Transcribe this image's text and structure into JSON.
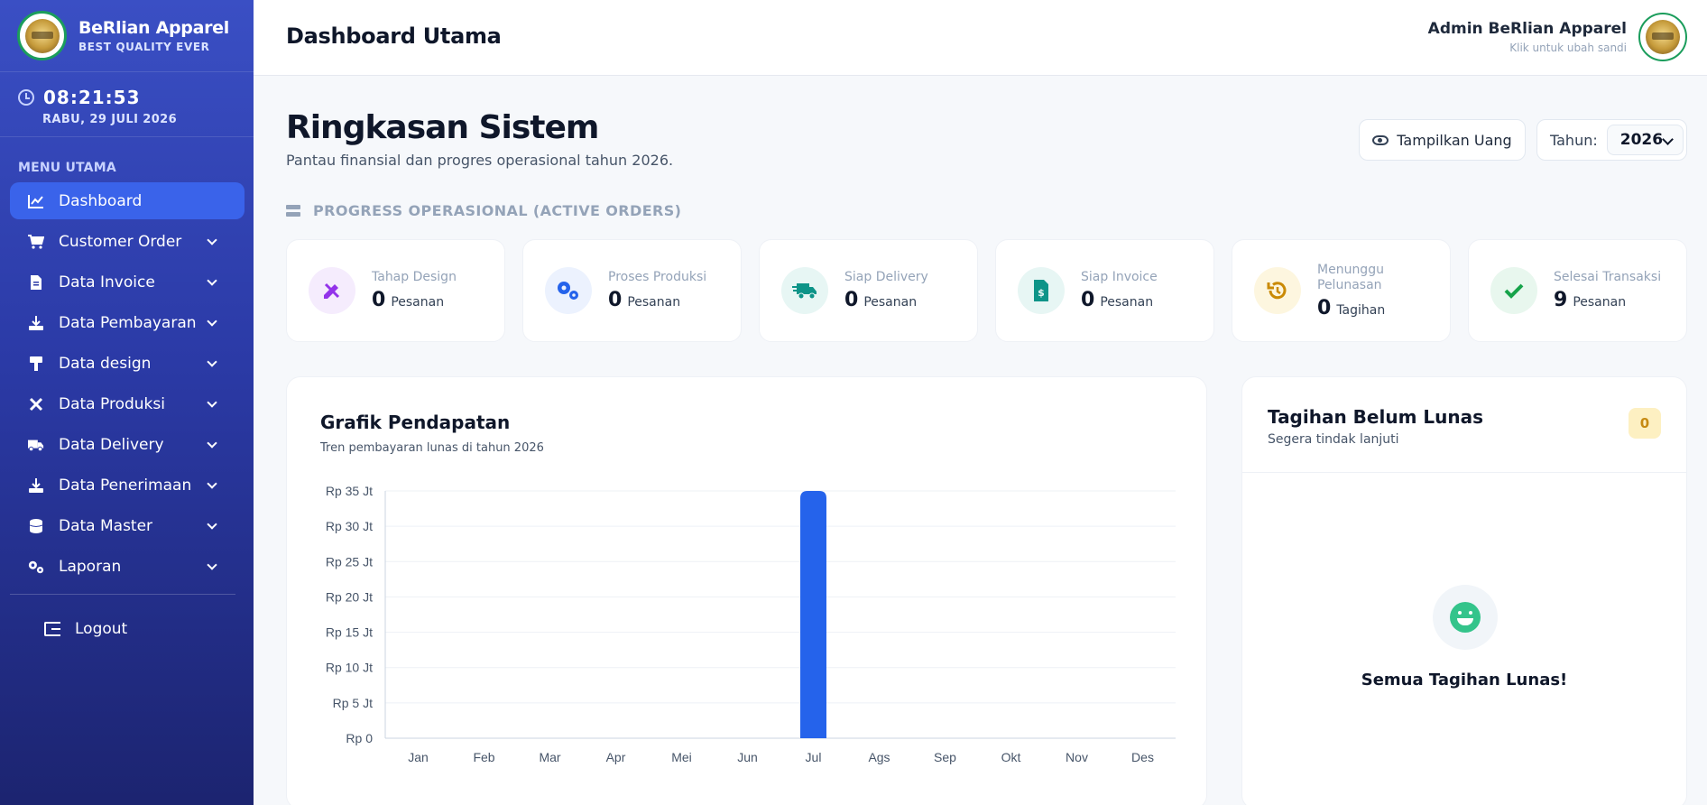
{
  "brand": {
    "name": "BeRlian Apparel",
    "tagline": "BEST QUALITY EVER"
  },
  "clock": {
    "time": "08:21:53",
    "date": "RABU, 29 JULI 2026"
  },
  "sidebar": {
    "menu_title": "MENU UTAMA",
    "items": [
      {
        "label": "Dashboard",
        "icon": "chart-line-icon",
        "active": true,
        "expandable": false
      },
      {
        "label": "Customer Order",
        "icon": "cart-icon",
        "active": false,
        "expandable": true
      },
      {
        "label": "Data Invoice",
        "icon": "invoice-icon",
        "active": false,
        "expandable": true
      },
      {
        "label": "Data Pembayaran",
        "icon": "download-icon",
        "active": false,
        "expandable": true
      },
      {
        "label": "Data design",
        "icon": "paint-roller-icon",
        "active": false,
        "expandable": true
      },
      {
        "label": "Data Produksi",
        "icon": "tools-icon",
        "active": false,
        "expandable": true
      },
      {
        "label": "Data Delivery",
        "icon": "truck-icon",
        "active": false,
        "expandable": true
      },
      {
        "label": "Data Penerimaan",
        "icon": "download-icon",
        "active": false,
        "expandable": true
      },
      {
        "label": "Data Master",
        "icon": "database-icon",
        "active": false,
        "expandable": true
      },
      {
        "label": "Laporan",
        "icon": "gears-icon",
        "active": false,
        "expandable": true
      }
    ],
    "logout_label": "Logout"
  },
  "header": {
    "title": "Dashboard Utama",
    "user_name": "Admin BeRlian Apparel",
    "user_hint": "Klik untuk ubah sandi"
  },
  "main": {
    "title": "Ringkasan Sistem",
    "subtitle": "Pantau finansial dan progres operasional tahun 2026.",
    "show_money_label": "Tampilkan Uang",
    "year_label": "Tahun:",
    "year_value": "2026",
    "section_title": "PROGRESS OPERASIONAL (ACTIVE ORDERS)"
  },
  "stats": [
    {
      "label": "Tahap Design",
      "value": "0",
      "unit": "Pesanan",
      "icon": "pencil-ruler-icon",
      "color": "#9333ea",
      "bg": "#f5ecfd"
    },
    {
      "label": "Proses Produksi",
      "value": "0",
      "unit": "Pesanan",
      "icon": "cogs-icon",
      "color": "#2563eb",
      "bg": "#ecf2fe"
    },
    {
      "label": "Siap Delivery",
      "value": "0",
      "unit": "Pesanan",
      "icon": "truck-fast-icon",
      "color": "#0d9488",
      "bg": "#e7f6f4"
    },
    {
      "label": "Siap Invoice",
      "value": "0",
      "unit": "Pesanan",
      "icon": "file-invoice-dollar-icon",
      "color": "#0d9488",
      "bg": "#e7f6f4"
    },
    {
      "label": "Menunggu Pelunasan",
      "value": "0",
      "unit": "Tagihan",
      "icon": "history-icon",
      "color": "#ca8a04",
      "bg": "#fdf6df"
    },
    {
      "label": "Selesai Transaksi",
      "value": "9",
      "unit": "Pesanan",
      "icon": "check-icon",
      "color": "#16a34a",
      "bg": "#e8f7ee"
    }
  ],
  "chart": {
    "title": "Grafik Pendapatan",
    "subtitle": "Tren pembayaran lunas di tahun 2026"
  },
  "chart_data": {
    "type": "bar",
    "categories": [
      "Jan",
      "Feb",
      "Mar",
      "Apr",
      "Mei",
      "Jun",
      "Jul",
      "Ags",
      "Sep",
      "Okt",
      "Nov",
      "Des"
    ],
    "values": [
      0,
      0,
      0,
      0,
      0,
      0,
      35,
      0,
      0,
      0,
      0,
      0
    ],
    "unit": "Jt",
    "y_ticks": [
      "Rp 0",
      "Rp 5 Jt",
      "Rp 10 Jt",
      "Rp 15 Jt",
      "Rp 20 Jt",
      "Rp 25 Jt",
      "Rp 30 Jt",
      "Rp 35 Jt"
    ],
    "ylim": [
      0,
      35
    ],
    "bar_color": "#2563eb",
    "grid": true
  },
  "bills": {
    "title": "Tagihan Belum Lunas",
    "subtitle": "Segera tindak lanjuti",
    "count": "0",
    "empty_message": "Semua Tagihan Lunas!"
  }
}
